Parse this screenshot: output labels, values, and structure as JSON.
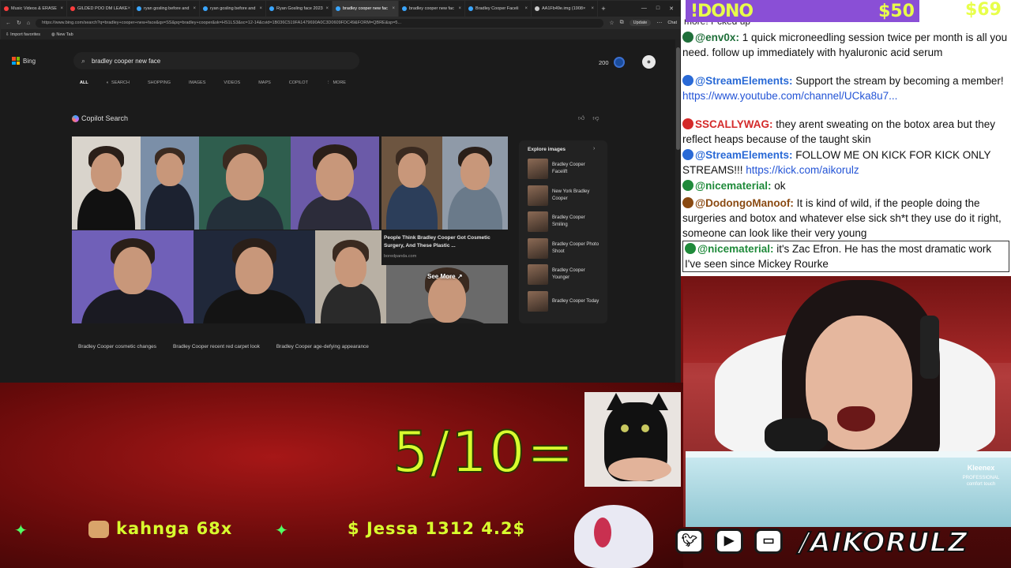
{
  "browser": {
    "tabs": [
      {
        "label": "Music Videos & ERASE",
        "color": "#ff3d3d"
      },
      {
        "label": "GILDED POO DM LEAKE",
        "color": "#ff3d3d"
      },
      {
        "label": "ryan gosling before and",
        "color": "#3aa6ff"
      },
      {
        "label": "ryan gosling before and",
        "color": "#3aa6ff"
      },
      {
        "label": "Ryan Gosling face 2023",
        "color": "#3aa6ff"
      },
      {
        "label": "bradley cooper new fac",
        "color": "#3aa6ff",
        "active": true
      },
      {
        "label": "bradley cooper new fac",
        "color": "#3aa6ff"
      },
      {
        "label": "Bradley Cooper Faceli",
        "color": "#3aa6ff"
      },
      {
        "label": "AA1Fb49e.img (1908×",
        "color": "#cccccc"
      }
    ],
    "url": "https://www.bing.com/search?q=bradley+cooper+new+face&qs=SS&pq=bradley+cooper&sk=HS1LS3&sc=12-14&cvid=1B036C519FA1479690A0C3D0609FDC49&FORM=QBRE&sp=5...",
    "update_label": "Update",
    "chat_label": "Chat",
    "favorites": [
      "Import favorites",
      "New Tab"
    ]
  },
  "bing": {
    "logo": "Bing",
    "query": "bradley cooper new face",
    "rewards": "200",
    "scopes": [
      "ALL",
      "SEARCH",
      "SHOPPING",
      "IMAGES",
      "VIDEOS",
      "MAPS",
      "COPILOT",
      "MORE"
    ],
    "copilot_title": "Copilot Search",
    "caption_title": "People Think Bradley Cooper Got Cosmetic Surgery, And These Plastic ...",
    "caption_source": "boredpanda.com",
    "see_more": "See More",
    "explore_title": "Explore images",
    "explore_items": [
      "Bradley Cooper Facelift",
      "New York Bradley Cooper",
      "Bradley Cooper Smiling",
      "Bradley Cooper Photo Shoot",
      "Bradley Cooper Younger",
      "Bradley Cooper Today"
    ],
    "related": [
      "Bradley Cooper cosmetic changes",
      "Bradley Cooper recent red carpet look",
      "Bradley Cooper age-defying appearance"
    ]
  },
  "dono": {
    "label": "!DONO",
    "amount": "$50",
    "right": "$69"
  },
  "chat": {
    "top_fragment": "more! f*cked up",
    "messages": [
      {
        "user": "@env0x:",
        "text": "1 quick microneedling session twice per month is all you need. follow up immediately with hyaluronic acid serum",
        "color": "#1f6f3a"
      },
      {
        "user": "@StreamElements:",
        "text": "Support the stream by becoming a member!",
        "link": "https://www.youtube.com/channel/UCka8u7...",
        "color": "#2a6ad6"
      },
      {
        "user": "SSCALLYWAG:",
        "text": "they arent sweating on the botox area but they reflect heaps because of the taught skin",
        "color": "#d42a2a"
      },
      {
        "user": "@StreamElements:",
        "text": "FOLLOW ME ON KICK FOR KICK ONLY STREAMS!!!",
        "link": "https://kick.com/aikorulz",
        "color": "#2a6ad6"
      },
      {
        "user": "@nicematerial:",
        "text": "ok",
        "color": "#1f8a3a"
      },
      {
        "user": "@DodongoManoof:",
        "text": "It is kind of wild, if the people doing the surgeries and botox and whatever else sick sh*t they use do it right, someone can look like their very young",
        "color": "#8a4a12"
      },
      {
        "user": "@nicematerial:",
        "text": "it's Zac Efron. He has the most dramatic work I've seen since Mickey Rourke",
        "color": "#1f8a3a"
      }
    ]
  },
  "overlay": {
    "score": "5/10=",
    "ticker": [
      {
        "name": "kahnga",
        "value": "68x"
      },
      {
        "prefix": "$",
        "name": "Jessa",
        "value": "1312 4.2$"
      }
    ],
    "tissue_brand": "Kleenex",
    "tissue_sub": "PROFESSIONAL comfort touch",
    "handle": "/AIKORULZ",
    "socials": [
      "twitter",
      "youtube",
      "twitch"
    ]
  },
  "colors": {
    "accent_green": "#d8ff2e",
    "dono_purple": "#8a4fd6",
    "link_blue": "#2354d6"
  }
}
